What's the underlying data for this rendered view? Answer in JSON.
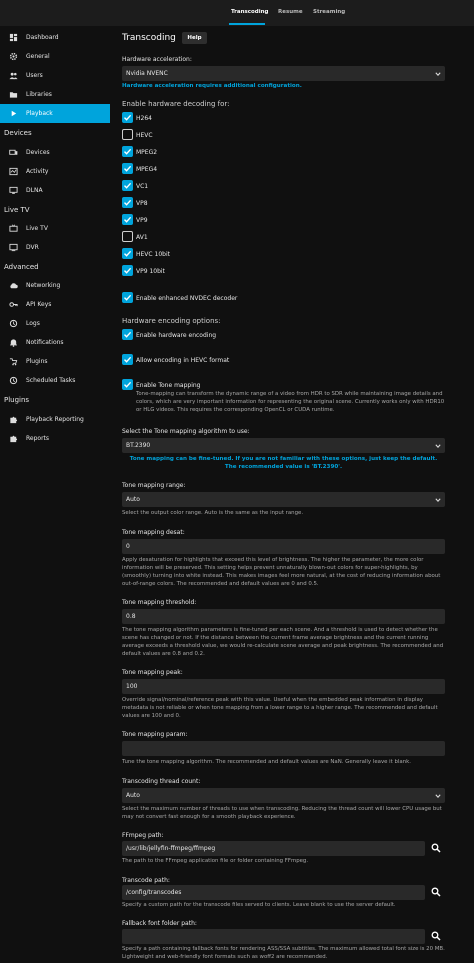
{
  "topbar": {
    "tabs": [
      {
        "label": "Transcoding",
        "active": true
      },
      {
        "label": "Resume",
        "active": false
      },
      {
        "label": "Streaming",
        "active": false
      }
    ]
  },
  "sidebar": {
    "items_server": [
      {
        "label": "Dashboard",
        "icon": "dashboard-icon"
      },
      {
        "label": "General",
        "icon": "gear-icon"
      },
      {
        "label": "Users",
        "icon": "users-icon"
      },
      {
        "label": "Libraries",
        "icon": "folder-icon"
      },
      {
        "label": "Playback",
        "icon": "play-icon",
        "active": true
      }
    ],
    "devices_header": "Devices",
    "items_devices": [
      {
        "label": "Devices",
        "icon": "devices-icon"
      },
      {
        "label": "Activity",
        "icon": "activity-icon"
      },
      {
        "label": "DLNA",
        "icon": "dlna-icon"
      }
    ],
    "livetv_header": "Live TV",
    "items_livetv": [
      {
        "label": "Live TV",
        "icon": "tv-icon"
      },
      {
        "label": "DVR",
        "icon": "dvr-icon"
      }
    ],
    "advanced_header": "Advanced",
    "items_advanced": [
      {
        "label": "Networking",
        "icon": "cloud-icon"
      },
      {
        "label": "API Keys",
        "icon": "key-icon"
      },
      {
        "label": "Logs",
        "icon": "logs-icon"
      },
      {
        "label": "Notifications",
        "icon": "bell-icon"
      },
      {
        "label": "Plugins",
        "icon": "plug-icon"
      },
      {
        "label": "Scheduled Tasks",
        "icon": "clock-icon"
      }
    ],
    "plugins_header": "Plugins",
    "items_plugins": [
      {
        "label": "Playback Reporting",
        "icon": "puzzle-icon"
      },
      {
        "label": "Reports",
        "icon": "puzzle-icon"
      }
    ]
  },
  "main": {
    "title": "Transcoding",
    "help_label": "Help",
    "hw_accel_label": "Hardware acceleration:",
    "hw_accel_value": "Nvidia NVENC",
    "hw_accel_note": "Hardware acceleration requires additional configuration.",
    "decoding_section": "Enable hardware decoding for:",
    "decoders": [
      {
        "label": "H264",
        "checked": true
      },
      {
        "label": "HEVC",
        "checked": false
      },
      {
        "label": "MPEG2",
        "checked": true
      },
      {
        "label": "MPEG4",
        "checked": true
      },
      {
        "label": "VC1",
        "checked": true
      },
      {
        "label": "VP8",
        "checked": true
      },
      {
        "label": "VP9",
        "checked": true
      },
      {
        "label": "AV1",
        "checked": false
      },
      {
        "label": "HEVC 10bit",
        "checked": true
      },
      {
        "label": "VP9 10bit",
        "checked": true
      }
    ],
    "nvdec_label": "Enable enhanced NVDEC decoder",
    "encoding_section": "Hardware encoding options:",
    "enable_hw_encoding": "Enable hardware encoding",
    "allow_hevc": "Allow encoding in HEVC format",
    "enable_tone_mapping": "Enable Tone mapping",
    "tone_mapping_desc": "Tone-mapping can transform the dynamic range of a video from HDR to SDR while maintaining image details and colors, which are very important information for representing the original scene. Currently works only with HDR10 or HLG videos. This requires the corresponding OpenCL or CUDA runtime.",
    "tm_algorithm_label": "Select the Tone mapping algorithm to use:",
    "tm_algorithm_value": "BT.2390",
    "tm_algorithm_note": "Tone mapping can be fine-tuned. If you are not familiar with these options, just keep the default. The recommended value is 'BT.2390'.",
    "tm_range_label": "Tone mapping range:",
    "tm_range_value": "Auto",
    "tm_range_desc": "Select the output color range. Auto is the same as the input range.",
    "tm_desat_label": "Tone mapping desat:",
    "tm_desat_value": "0",
    "tm_desat_desc": "Apply desaturation for highlights that exceed this level of brightness. The higher the parameter, the more color information will be preserved. This setting helps prevent unnaturally blown-out colors for super-highlights, by (smoothly) turning into white instead. This makes images feel more natural, at the cost of reducing information about out-of-range colors. The recommended and default values are 0 and 0.5.",
    "tm_threshold_label": "Tone mapping threshold:",
    "tm_threshold_value": "0.8",
    "tm_threshold_desc": "The tone mapping algorithm parameters is fine-tuned per each scene. And a threshold is used to detect whether the scene has changed or not. If the distance between the current frame average brightness and the current running average exceeds a threshold value, we would re-calculate scene average and peak brightness. The recommended and default values are 0.8 and 0.2.",
    "tm_peak_label": "Tone mapping peak:",
    "tm_peak_value": "100",
    "tm_peak_desc": "Override signal/nominal/reference peak with this value. Useful when the embedded peak information in display metadata is not reliable or when tone mapping from a lower range to a higher range. The recommended and default values are 100 and 0.",
    "tm_param_label": "Tone mapping param:",
    "tm_param_value": "",
    "tm_param_desc": "Tune the tone mapping algorithm. The recommended and default values are NaN. Generally leave it blank.",
    "thread_count_label": "Transcoding thread count:",
    "thread_count_value": "Auto",
    "thread_count_desc": "Select the maximum number of threads to use when transcoding. Reducing the thread count will lower CPU usage but may not convert fast enough for a smooth playback experience.",
    "ffmpeg_label": "FFmpeg path:",
    "ffmpeg_value": "/usr/lib/jellyfin-ffmpeg/ffmpeg",
    "ffmpeg_desc": "The path to the FFmpeg application file or folder containing FFmpeg.",
    "transcode_path_label": "Transcode path:",
    "transcode_path_value": "/config/transcodes",
    "transcode_path_desc": "Specify a custom path for the transcode files served to clients. Leave blank to use the server default.",
    "fallback_font_label": "Fallback font folder path:",
    "fallback_font_value": "",
    "fallback_font_desc": "Specify a path containing fallback fonts for rendering ASS/SSA subtitles. The maximum allowed total font size is 20 MB. Lightweight and web-friendly font formats such as woff2 are recommended."
  },
  "colors": {
    "accent": "#00a4dc",
    "background": "#101010",
    "input": "#292929"
  }
}
